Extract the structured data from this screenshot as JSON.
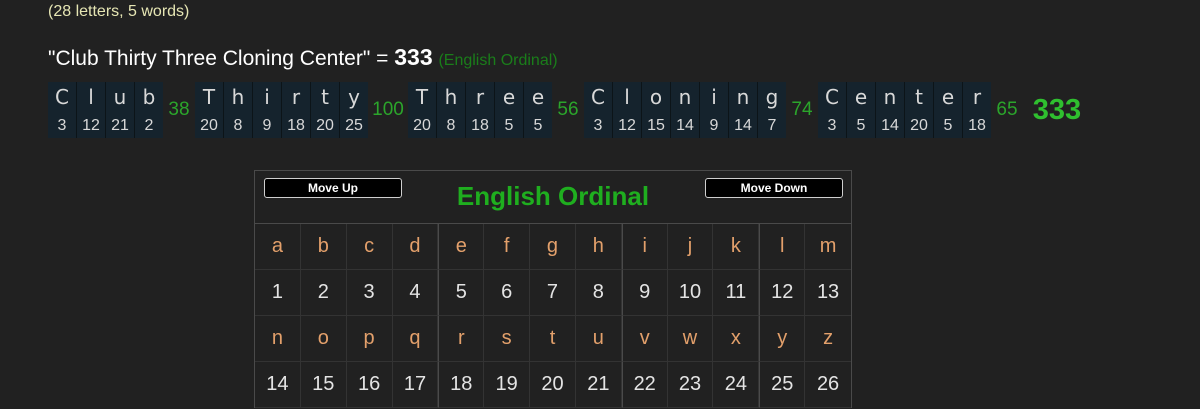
{
  "summary": "(28 letters, 5 words)",
  "phrase": {
    "text": "\"Club Thirty Three Cloning Center\"",
    "equals": "=",
    "total": "333",
    "cipher_name": "(English Ordinal)"
  },
  "breakdown": {
    "words": [
      {
        "letters": [
          {
            "ch": "C",
            "n": "3"
          },
          {
            "ch": "l",
            "n": "12"
          },
          {
            "ch": "u",
            "n": "21"
          },
          {
            "ch": "b",
            "n": "2"
          }
        ],
        "sum": "38"
      },
      {
        "letters": [
          {
            "ch": "T",
            "n": "20"
          },
          {
            "ch": "h",
            "n": "8"
          },
          {
            "ch": "i",
            "n": "9"
          },
          {
            "ch": "r",
            "n": "18"
          },
          {
            "ch": "t",
            "n": "20"
          },
          {
            "ch": "y",
            "n": "25"
          }
        ],
        "sum": "100"
      },
      {
        "letters": [
          {
            "ch": "T",
            "n": "20"
          },
          {
            "ch": "h",
            "n": "8"
          },
          {
            "ch": "r",
            "n": "18"
          },
          {
            "ch": "e",
            "n": "5"
          },
          {
            "ch": "e",
            "n": "5"
          }
        ],
        "sum": "56"
      },
      {
        "letters": [
          {
            "ch": "C",
            "n": "3"
          },
          {
            "ch": "l",
            "n": "12"
          },
          {
            "ch": "o",
            "n": "15"
          },
          {
            "ch": "n",
            "n": "14"
          },
          {
            "ch": "i",
            "n": "9"
          },
          {
            "ch": "n",
            "n": "14"
          },
          {
            "ch": "g",
            "n": "7"
          }
        ],
        "sum": "74"
      },
      {
        "letters": [
          {
            "ch": "C",
            "n": "3"
          },
          {
            "ch": "e",
            "n": "5"
          },
          {
            "ch": "n",
            "n": "14"
          },
          {
            "ch": "t",
            "n": "20"
          },
          {
            "ch": "e",
            "n": "5"
          },
          {
            "ch": "r",
            "n": "18"
          }
        ],
        "sum": "65"
      }
    ],
    "grand_total": "333"
  },
  "cipher_panel": {
    "title": "English Ordinal",
    "move_up_label": "Move Up",
    "move_down_label": "Move Down",
    "rows": [
      {
        "type": "letter",
        "cells": [
          "a",
          "b",
          "c",
          "d",
          "e",
          "f",
          "g",
          "h",
          "i",
          "j",
          "k",
          "l",
          "m"
        ]
      },
      {
        "type": "value",
        "cells": [
          "1",
          "2",
          "3",
          "4",
          "5",
          "6",
          "7",
          "8",
          "9",
          "10",
          "11",
          "12",
          "13"
        ]
      },
      {
        "type": "letter",
        "cells": [
          "n",
          "o",
          "p",
          "q",
          "r",
          "s",
          "t",
          "u",
          "v",
          "w",
          "x",
          "y",
          "z"
        ]
      },
      {
        "type": "value",
        "cells": [
          "14",
          "15",
          "16",
          "17",
          "18",
          "19",
          "20",
          "21",
          "22",
          "23",
          "24",
          "25",
          "26"
        ]
      }
    ]
  },
  "colors": {
    "background": "#212121",
    "summary_text": "#e6e6b4",
    "word_sum": "#2ba52b",
    "letter_box_bg": "#15232d",
    "grid_letter": "#e3a06b",
    "title_green": "#1fae1f"
  }
}
